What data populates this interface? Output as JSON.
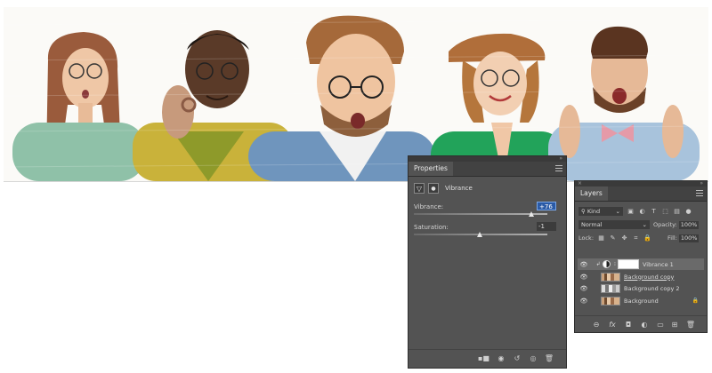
{
  "properties": {
    "tab": "Properties",
    "adjustment_title": "Vibrance",
    "vibrance_label": "Vibrance:",
    "vibrance_value": "+76",
    "vibrance_level": 76,
    "saturation_label": "Saturation:",
    "saturation_value": "-1",
    "saturation_level": -1,
    "icons": [
      "clip-to-layer-icon",
      "view-previous-icon",
      "reset-icon",
      "visibility-icon",
      "delete-icon"
    ]
  },
  "layers": {
    "tab": "Layers",
    "filter_kind": "Kind",
    "blend_mode": "Normal",
    "opacity_label": "Opacity:",
    "opacity_value": "100%",
    "lock_label": "Lock:",
    "fill_label": "Fill:",
    "fill_value": "100%",
    "items": [
      {
        "name": "Vibrance 1",
        "selected": true
      },
      {
        "name": "Background copy",
        "selected": false
      },
      {
        "name": "Background copy 2",
        "selected": false
      },
      {
        "name": "Background",
        "selected": false
      }
    ],
    "footer_icons": [
      "link-icon",
      "fx-icon",
      "mask-icon",
      "adjustment-icon",
      "group-icon",
      "new-layer-icon",
      "delete-icon"
    ]
  },
  "colors": {
    "panel_bg": "#535353",
    "tab_bar": "#424242",
    "selected_layer": "#6a6a6a",
    "active_field": "#2a5aa6"
  }
}
